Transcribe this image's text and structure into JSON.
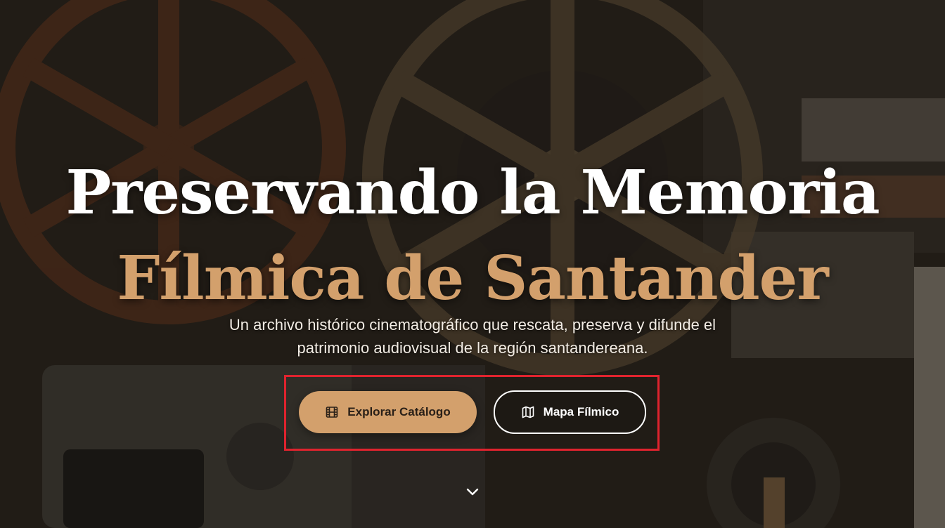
{
  "hero": {
    "title_line1": "Preservando la Memoria",
    "title_line2": "Fílmica de Santander",
    "subtitle_line1": "Un archivo histórico cinematográfico que rescata, preserva y difunde el",
    "subtitle_line2": "patrimonio audiovisual de la región santandereana.",
    "background_image": "film-reels-and-projector-photo"
  },
  "actions": {
    "primary": {
      "label": "Explorar Catálogo",
      "icon": "film-icon"
    },
    "secondary": {
      "label": "Mapa Fílmico",
      "icon": "map-icon"
    }
  },
  "scroll_indicator": {
    "icon": "chevron-down-icon"
  },
  "colors": {
    "accent": "#d3a06c",
    "title": "#ffffff",
    "highlight_box": "#e0232e"
  }
}
